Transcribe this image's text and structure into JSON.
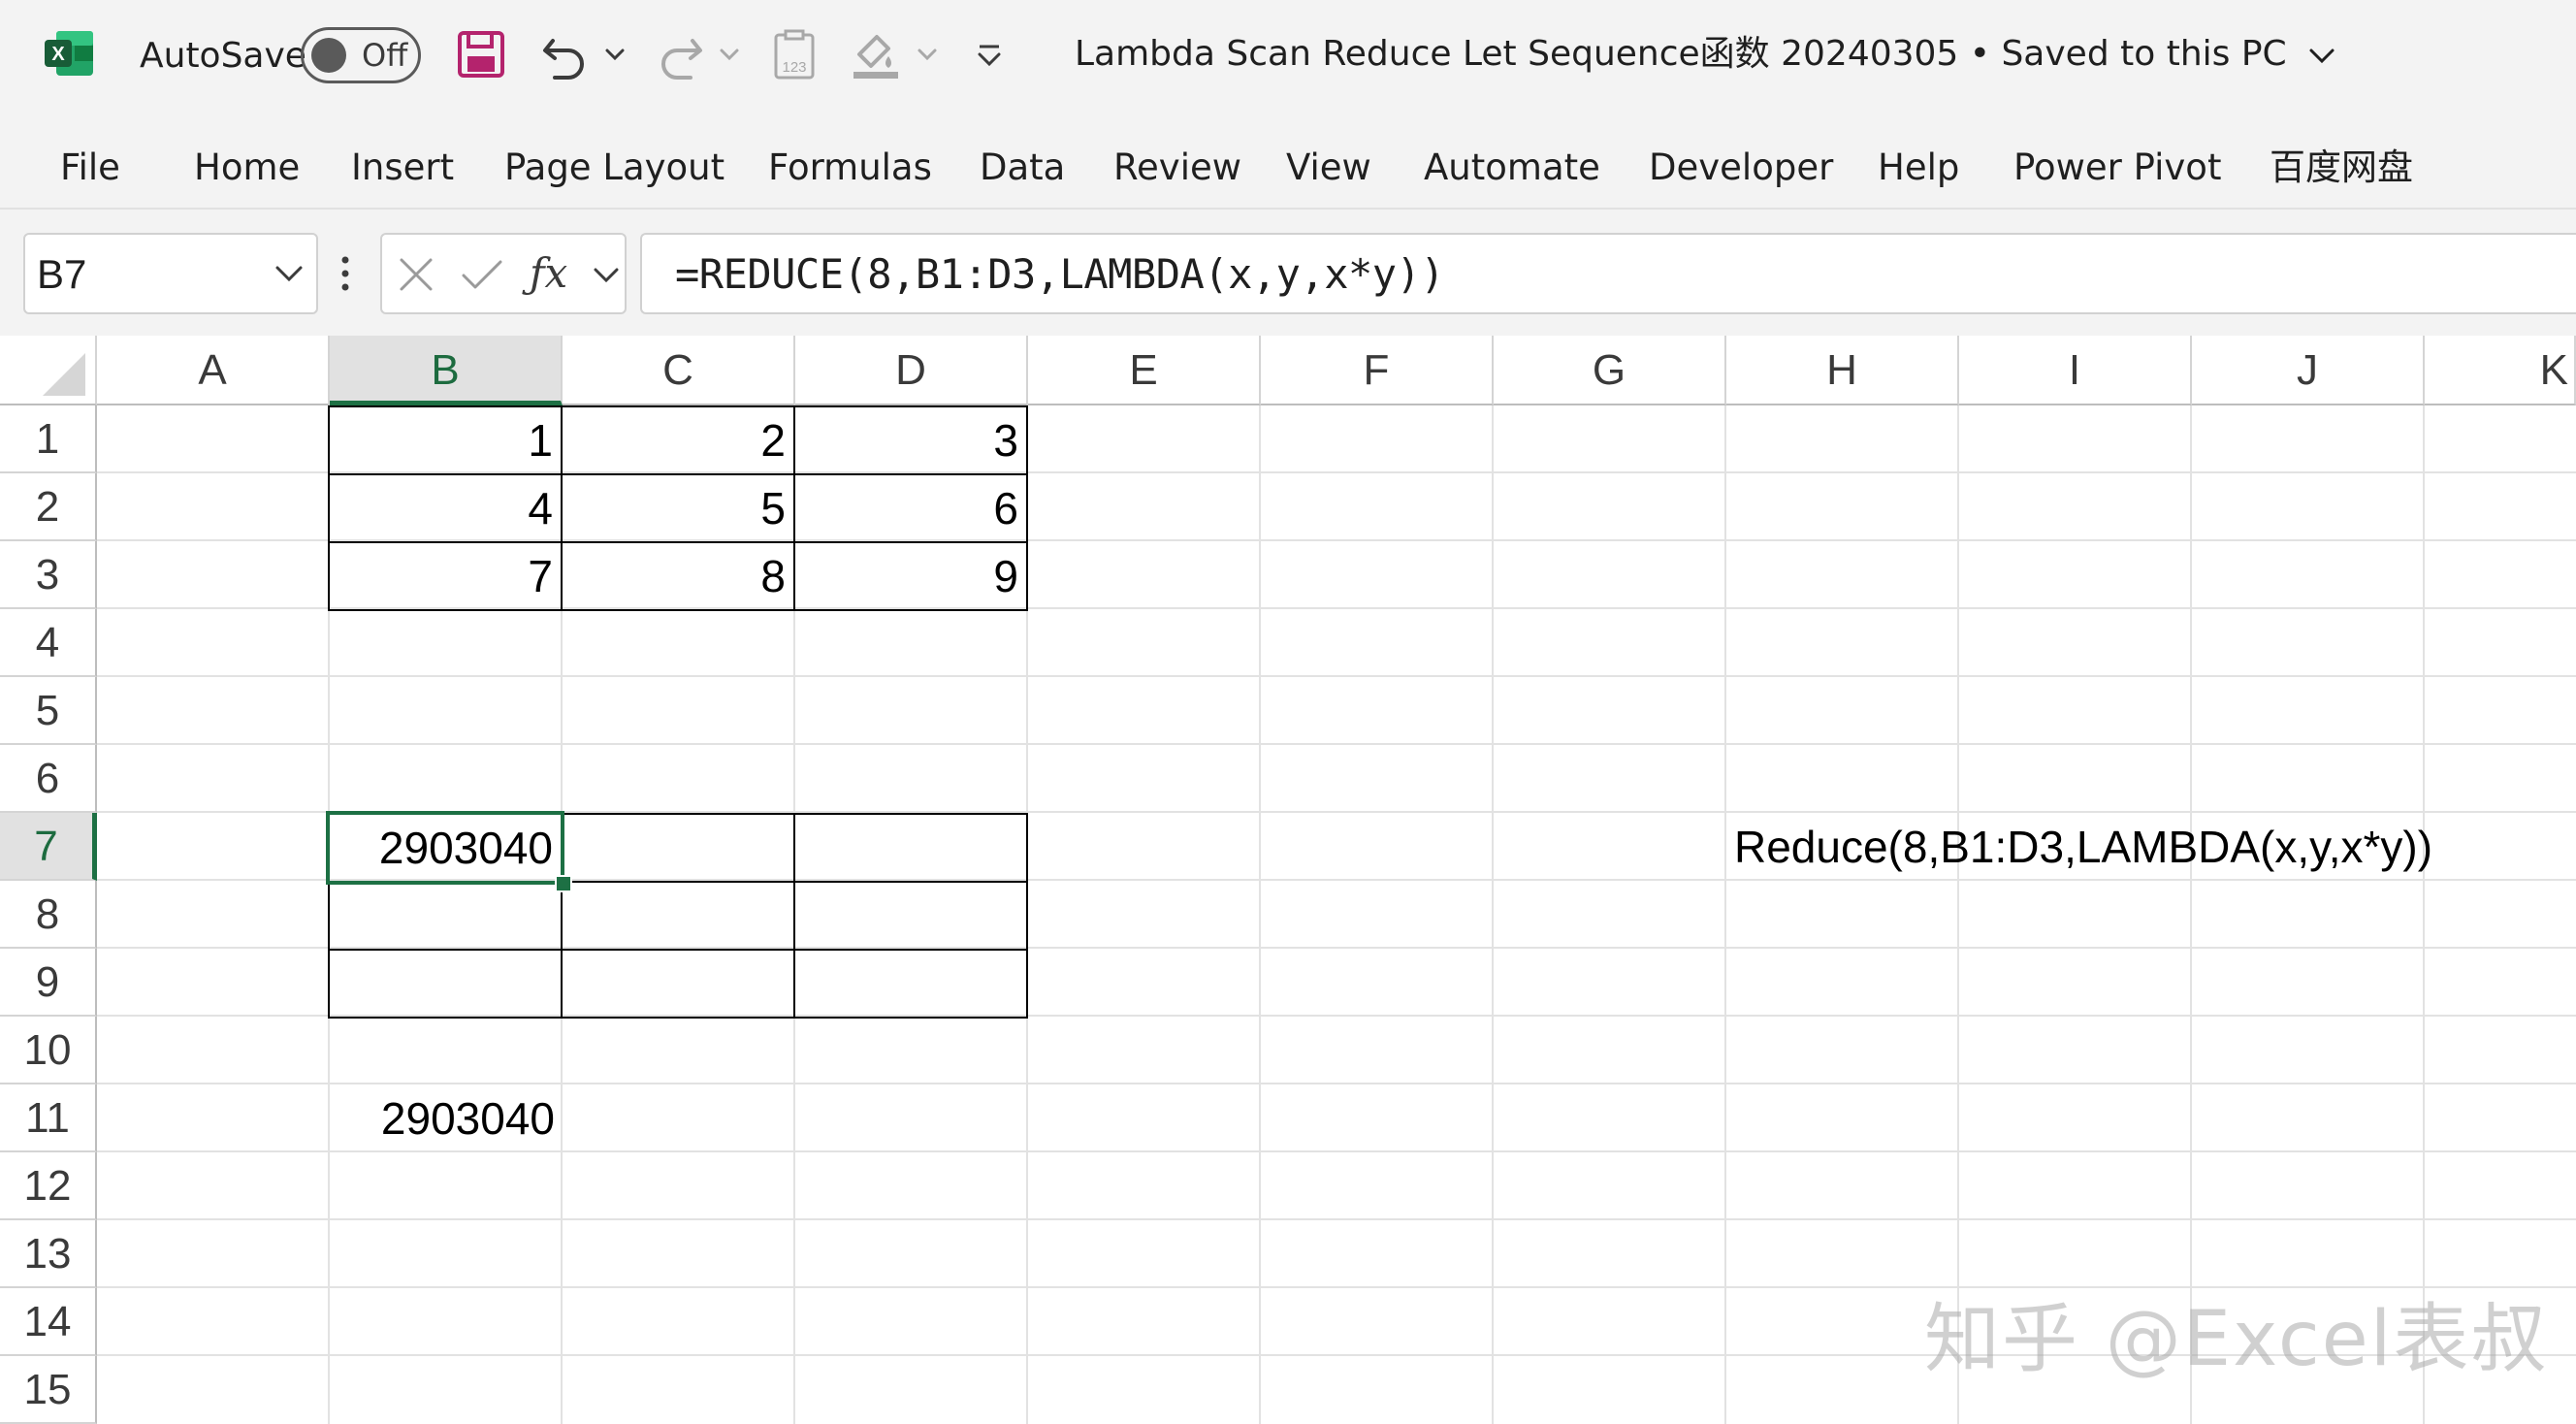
{
  "titlebar": {
    "autosave_label": "AutoSave",
    "autosave_state": "Off",
    "doc_title": "Lambda Scan Reduce Let Sequence函数 20240305 • Saved to this PC",
    "icons": [
      "excel-logo-icon",
      "save-icon",
      "undo-icon",
      "redo-icon",
      "form-icon",
      "format-painter-icon",
      "customize-toolbar-icon"
    ]
  },
  "ribbon": {
    "tabs": [
      "File",
      "Home",
      "Insert",
      "Page Layout",
      "Formulas",
      "Data",
      "Review",
      "View",
      "Automate",
      "Developer",
      "Help",
      "Power Pivot",
      "百度网盘"
    ]
  },
  "formula_bar": {
    "name_box": "B7",
    "formula": "=REDUCE(8,B1:D3,LAMBDA(x,y,x*y))"
  },
  "sheet": {
    "columns": [
      "A",
      "B",
      "C",
      "D",
      "E",
      "F",
      "G",
      "H",
      "I",
      "J",
      "K"
    ],
    "rows": [
      "1",
      "2",
      "3",
      "4",
      "5",
      "6",
      "7",
      "8",
      "9",
      "10",
      "11",
      "12",
      "13",
      "14",
      "15"
    ],
    "selected_cell": "B7",
    "cells": {
      "B1": "1",
      "C1": "2",
      "D1": "3",
      "B2": "4",
      "C2": "5",
      "D2": "6",
      "B3": "7",
      "C3": "8",
      "D3": "9",
      "B7": "2903040",
      "H7": "Reduce(8,B1:D3,LAMBDA(x,y,x*y))",
      "B11": "2903040"
    }
  },
  "watermark": "知乎 @Excel表叔",
  "colors": {
    "accent": "#1d7044",
    "chrome": "#f3f3f3"
  }
}
